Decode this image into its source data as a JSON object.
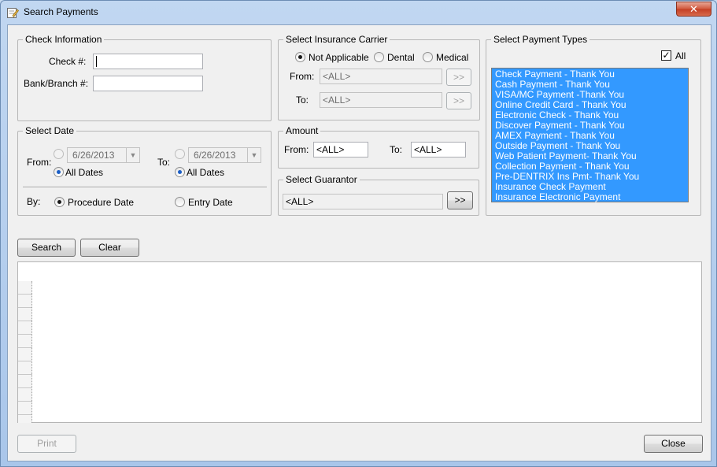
{
  "window": {
    "title": "Search Payments",
    "close_glyph": "✕"
  },
  "check_info": {
    "legend": "Check Information",
    "check_label": "Check #:",
    "check_value": "",
    "bank_label": "Bank/Branch #:",
    "bank_value": ""
  },
  "insurance": {
    "legend": "Select Insurance Carrier",
    "options": [
      {
        "label": "Not Applicable",
        "checked": true
      },
      {
        "label": "Dental",
        "checked": false
      },
      {
        "label": "Medical",
        "checked": false
      }
    ],
    "from_label": "From:",
    "from_value": "<ALL>",
    "to_label": "To:",
    "to_value": "<ALL>",
    "browse_label": ">>"
  },
  "payment_types": {
    "legend": "Select Payment Types",
    "all_label": "All",
    "all_checked": true,
    "items": [
      "Check Payment - Thank You",
      "Cash Payment - Thank You",
      "VISA/MC Payment -Thank You",
      "Online Credit Card - Thank You",
      "Electronic Check - Thank You",
      "Discover Payment - Thank You",
      "AMEX Payment - Thank You",
      "Outside Payment - Thank You",
      "Web Patient Payment- Thank You",
      "Collection Payment - Thank You",
      "Pre-DENTRIX Ins Pmt- Thank You",
      "Insurance Check Payment",
      "Insurance Electronic Payment"
    ]
  },
  "date": {
    "legend": "Select Date",
    "from_label": "From:",
    "from_date": "6/26/2013",
    "to_label": "To:",
    "to_date": "6/26/2013",
    "all_dates_label": "All Dates",
    "by_label": "By:",
    "procedure_label": "Procedure Date",
    "entry_label": "Entry Date"
  },
  "amount": {
    "legend": "Amount",
    "from_label": "From:",
    "from_value": "<ALL>",
    "to_label": "To:",
    "to_value": "<ALL>"
  },
  "guarantor": {
    "legend": "Select Guarantor",
    "value": "<ALL>",
    "browse_label": ">>"
  },
  "actions": {
    "search": "Search",
    "clear": "Clear",
    "print": "Print",
    "close": "Close"
  }
}
